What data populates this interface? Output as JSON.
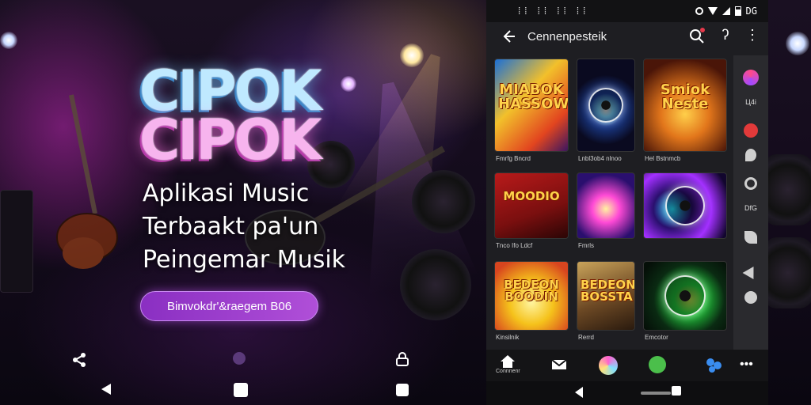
{
  "promo": {
    "logo_line1": "CIPOK",
    "logo_line2": "CIPOK",
    "tagline_line1": "Aplikasi Music",
    "tagline_line2": "Terbaakt pa'un",
    "tagline_line3": "Peingemar Musik",
    "cta_label": "Bimvokdr'&raegem B06"
  },
  "left_nav": {
    "icons": [
      "share-icon",
      "dot-indicator",
      "lock-icon",
      "back-triangle-icon",
      "home-square-icon",
      "recents-square-icon"
    ]
  },
  "phone": {
    "status_left": "⁞⁞ ⁞⁞ ⁞⁞ ⁞⁞",
    "status_right": "DG",
    "app_title": "Cennenpesteik",
    "albums": [
      {
        "title": "MIABOK\nHASSOW",
        "caption": "Fmrfg Bncrd",
        "theme": "comic"
      },
      {
        "title": "",
        "caption": "Lnbl3ob4 nlnoo",
        "theme": "disc-blue"
      },
      {
        "title": "Smiok\nNeste",
        "caption": "Hel Bstnmcb",
        "theme": "guitar-gold"
      },
      {
        "title": "MOODIO",
        "caption": "Tnco Ifo Ldcf",
        "theme": "guitar-red"
      },
      {
        "title": "",
        "caption": "Fmrls",
        "theme": "neon-guitarist"
      },
      {
        "title": "",
        "caption": "",
        "theme": "disc-neon"
      },
      {
        "title": "BEDEON\nBOODIN",
        "caption": "Kinsilnik",
        "theme": "comic-yellow"
      },
      {
        "title": "BEDEON\nBOSSTA",
        "caption": "Rerrd",
        "theme": "retro"
      },
      {
        "title": "",
        "caption": "Emcotor",
        "theme": "disc-green"
      }
    ],
    "side_rail": [
      {
        "label": "",
        "icon": "color-wheel-icon"
      },
      {
        "label": "Ц4і",
        "icon": "none"
      },
      {
        "label": "",
        "icon": "red-badge-icon"
      },
      {
        "label": "",
        "icon": "feather-icon"
      },
      {
        "label": "",
        "icon": "disc-icon"
      },
      {
        "label": "DfG",
        "icon": "none"
      },
      {
        "label": "",
        "icon": "leaf-icon"
      },
      {
        "label": "",
        "icon": "arrow-icon"
      },
      {
        "label": "",
        "icon": "minus-circle-icon"
      }
    ],
    "bottom_bar": {
      "home_label": "Connnenr",
      "items": [
        "home-icon",
        "mail-icon",
        "color-disc-icon",
        "green-radio-icon",
        "people-icon",
        "more-dots-icon"
      ]
    }
  },
  "colors": {
    "cta": "#9b3fd0",
    "logo_blue": "#bfe9ff",
    "logo_pink": "#f7b4ee",
    "phone_bg": "#1e1e22"
  }
}
